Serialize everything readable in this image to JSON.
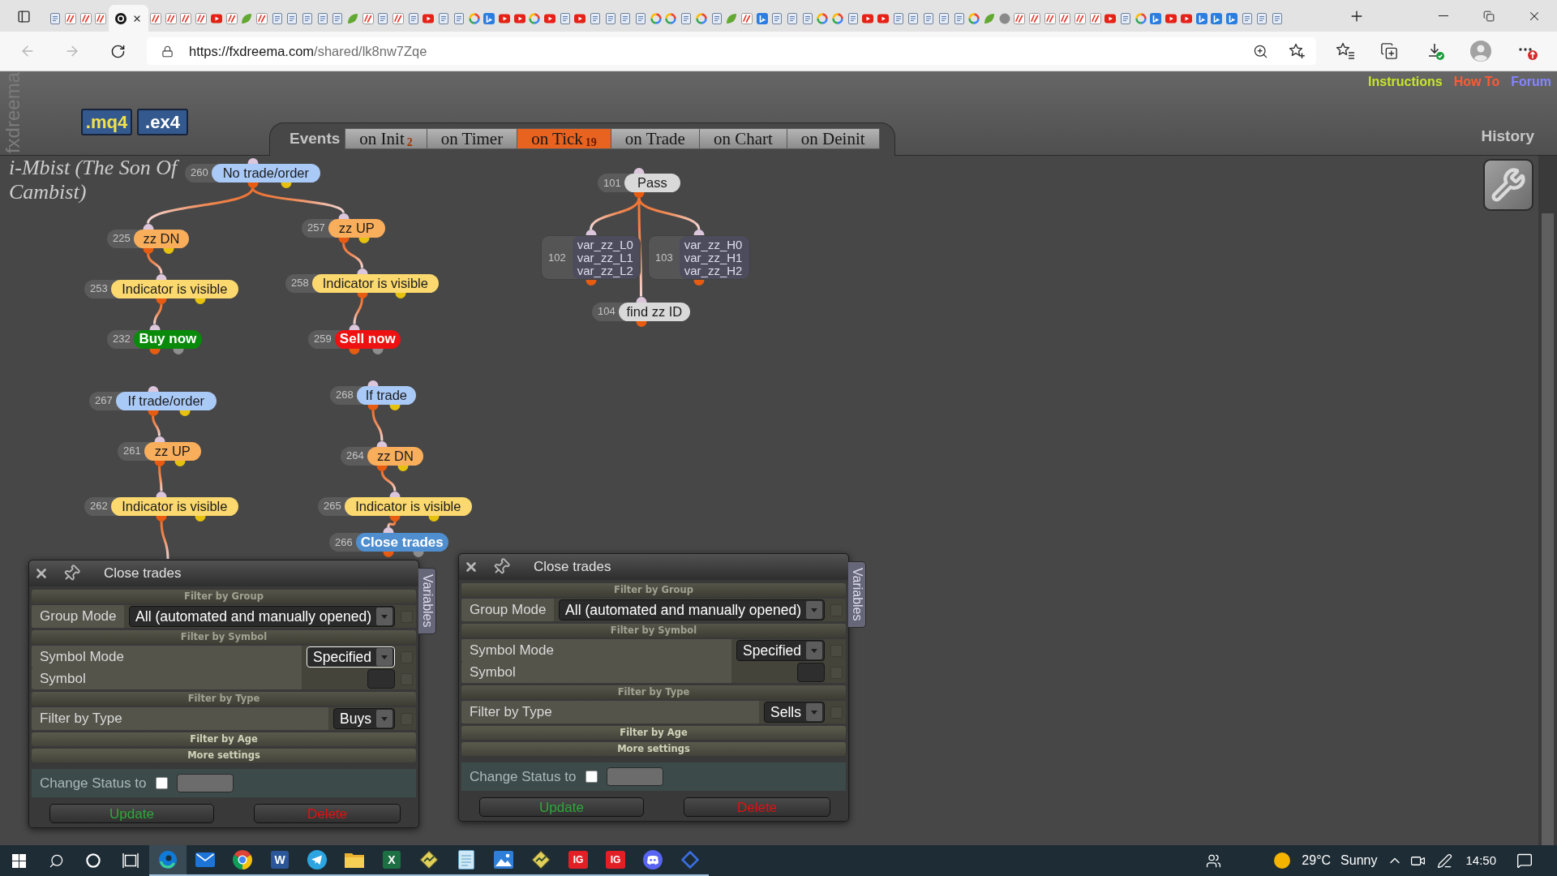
{
  "browser": {
    "tabs": [
      {
        "kind": "doc",
        "selected": false
      },
      {
        "kind": "fx",
        "selected": false
      },
      {
        "kind": "fx",
        "selected": false
      },
      {
        "kind": "fx",
        "selected": false
      },
      {
        "kind": "dark",
        "selected": true
      },
      {
        "kind": "fx",
        "selected": false
      },
      {
        "kind": "fx",
        "selected": false
      },
      {
        "kind": "fx",
        "selected": false
      },
      {
        "kind": "fx",
        "selected": false
      },
      {
        "kind": "video",
        "selected": false
      },
      {
        "kind": "fx",
        "selected": false
      },
      {
        "kind": "leaf",
        "selected": false
      },
      {
        "kind": "fx",
        "selected": false
      },
      {
        "kind": "doc",
        "selected": false
      },
      {
        "kind": "doc",
        "selected": false
      },
      {
        "kind": "doc",
        "selected": false
      },
      {
        "kind": "doc",
        "selected": false
      },
      {
        "kind": "doc",
        "selected": false
      },
      {
        "kind": "leaf",
        "selected": false
      },
      {
        "kind": "fx",
        "selected": false
      },
      {
        "kind": "doc",
        "selected": false
      },
      {
        "kind": "fx",
        "selected": false
      },
      {
        "kind": "doc",
        "selected": false
      },
      {
        "kind": "video",
        "selected": false
      },
      {
        "kind": "doc",
        "selected": false
      },
      {
        "kind": "doc",
        "selected": false
      },
      {
        "kind": "google",
        "selected": false
      },
      {
        "kind": "bing",
        "selected": false
      },
      {
        "kind": "video",
        "selected": false
      },
      {
        "kind": "video",
        "selected": false
      },
      {
        "kind": "google",
        "selected": false
      },
      {
        "kind": "video",
        "selected": false
      },
      {
        "kind": "doc",
        "selected": false
      },
      {
        "kind": "video",
        "selected": false
      },
      {
        "kind": "doc",
        "selected": false
      },
      {
        "kind": "doc",
        "selected": false
      },
      {
        "kind": "doc",
        "selected": false
      },
      {
        "kind": "doc",
        "selected": false
      },
      {
        "kind": "google",
        "selected": false
      },
      {
        "kind": "google",
        "selected": false
      },
      {
        "kind": "doc",
        "selected": false
      },
      {
        "kind": "google",
        "selected": false
      },
      {
        "kind": "doc",
        "selected": false
      },
      {
        "kind": "leaf",
        "selected": false
      },
      {
        "kind": "fx",
        "selected": false
      },
      {
        "kind": "bing",
        "selected": false
      },
      {
        "kind": "doc",
        "selected": false
      },
      {
        "kind": "doc",
        "selected": false
      },
      {
        "kind": "doc",
        "selected": false
      },
      {
        "kind": "google",
        "selected": false
      },
      {
        "kind": "google",
        "selected": false
      },
      {
        "kind": "doc",
        "selected": false
      },
      {
        "kind": "video",
        "selected": false
      },
      {
        "kind": "video",
        "selected": false
      },
      {
        "kind": "doc",
        "selected": false
      },
      {
        "kind": "doc",
        "selected": false
      },
      {
        "kind": "doc",
        "selected": false
      },
      {
        "kind": "doc",
        "selected": false
      },
      {
        "kind": "doc",
        "selected": false
      },
      {
        "kind": "google",
        "selected": false
      },
      {
        "kind": "leaf",
        "selected": false
      },
      {
        "kind": "circle",
        "selected": false
      },
      {
        "kind": "fx",
        "selected": false
      },
      {
        "kind": "fx",
        "selected": false
      },
      {
        "kind": "fx",
        "selected": false
      },
      {
        "kind": "fx",
        "selected": false
      },
      {
        "kind": "fx",
        "selected": false
      },
      {
        "kind": "fx",
        "selected": false
      },
      {
        "kind": "video",
        "selected": false
      },
      {
        "kind": "doc",
        "selected": false
      },
      {
        "kind": "google",
        "selected": false
      },
      {
        "kind": "bing",
        "selected": false
      },
      {
        "kind": "video",
        "selected": false
      },
      {
        "kind": "video",
        "selected": false
      },
      {
        "kind": "bing",
        "selected": false
      },
      {
        "kind": "bing",
        "selected": false
      },
      {
        "kind": "bing",
        "selected": false
      },
      {
        "kind": "doc",
        "selected": false
      },
      {
        "kind": "doc",
        "selected": false
      },
      {
        "kind": "doc",
        "selected": false
      }
    ],
    "address": {
      "host": "https://fxdreema.com",
      "path": "/shared/lk8nw7Zqe"
    }
  },
  "header": {
    "brand": "fxdreema",
    "export_buttons": [
      {
        "label": ".mq4",
        "color": "#f2e24a"
      },
      {
        "label": ".ex4",
        "color": "#ffffff"
      }
    ],
    "events_label": "Events",
    "event_tabs": [
      {
        "label": "on Init",
        "count": "2",
        "selected": false
      },
      {
        "label": "on Timer",
        "selected": false
      },
      {
        "label": "on Tick",
        "count": "19",
        "selected": true
      },
      {
        "label": "on Trade",
        "selected": false
      },
      {
        "label": "on Chart",
        "selected": false
      },
      {
        "label": "on Deinit",
        "selected": false
      }
    ],
    "links": [
      {
        "label": "Instructions",
        "color": "#c6e52e"
      },
      {
        "label": "How To",
        "color": "#ff5a36"
      },
      {
        "label": "Forum",
        "color": "#8585ff"
      }
    ],
    "history": "History"
  },
  "project_title": "i-Mbist (The Son Of Cambist)",
  "trees": [
    {
      "id": "260",
      "label": "No trade/order",
      "kind": "condition",
      "color": "#a9c9f7",
      "children": [
        {
          "id": "225",
          "label": "zz DN",
          "kind": "condition",
          "color": "#f9ae5c",
          "children": [
            {
              "id": "253",
              "label": "Indicator is visible",
              "kind": "condition",
              "color": "#fbd96f",
              "children": [
                {
                  "id": "232",
                  "label": "Buy now",
                  "kind": "action",
                  "color": "#0a8a0a"
                }
              ]
            }
          ]
        },
        {
          "id": "257",
          "label": "zz UP",
          "kind": "condition",
          "color": "#f9ae5c",
          "children": [
            {
              "id": "258",
              "label": "Indicator is visible",
              "kind": "condition",
              "color": "#fbd96f",
              "children": [
                {
                  "id": "259",
                  "label": "Sell now",
                  "kind": "action",
                  "color": "#ee1111"
                }
              ]
            }
          ]
        }
      ]
    },
    {
      "id": "267",
      "label": "If trade/order",
      "kind": "condition",
      "color": "#a9c9f7",
      "children": [
        {
          "id": "261",
          "label": "zz UP",
          "kind": "condition",
          "color": "#f9ae5c",
          "children": [
            {
              "id": "262",
              "label": "Indicator is visible",
              "kind": "condition",
              "color": "#fbd96f"
            }
          ]
        }
      ]
    },
    {
      "id": "268",
      "label": "If trade",
      "kind": "condition",
      "color": "#a9c9f7",
      "children": [
        {
          "id": "264",
          "label": "zz DN",
          "kind": "condition",
          "color": "#f9ae5c",
          "children": [
            {
              "id": "265",
              "label": "Indicator is visible",
              "kind": "condition",
              "color": "#fbd96f",
              "children": [
                {
                  "id": "266",
                  "label": "Close trades",
                  "kind": "action",
                  "color": "#4f8fd0"
                }
              ]
            }
          ]
        }
      ]
    },
    {
      "id": "101",
      "label": "Pass",
      "kind": "pass",
      "color": "#d9d9d9",
      "children": [
        {
          "id": "102",
          "lines": [
            "var_zz_L0",
            "var_zz_L1",
            "var_zz_L2"
          ],
          "kind": "variables",
          "color": "#4c4c5c"
        },
        {
          "id": "103",
          "lines": [
            "var_zz_H0",
            "var_zz_H1",
            "var_zz_H2"
          ],
          "kind": "variables",
          "color": "#4c4c5c"
        },
        {
          "id": "104",
          "label": "find zz ID",
          "kind": "pass",
          "color": "#d9d9d9"
        }
      ]
    }
  ],
  "dialogs": [
    {
      "title": "Close trades",
      "side_tab": "Variables",
      "sections": [
        {
          "heading": "Filter by Group",
          "expanded": true,
          "rows": [
            {
              "kind": "select",
              "label": "Group Mode",
              "value": "All (automated and manually opened)",
              "focused": false,
              "checked": false
            }
          ]
        },
        {
          "heading": "Filter by Symbol",
          "expanded": true,
          "rows": [
            {
              "kind": "select",
              "label": "Symbol Mode",
              "value": "Specified",
              "focused": true,
              "checked": false
            },
            {
              "kind": "input",
              "label": "Symbol",
              "checked": false
            }
          ]
        },
        {
          "heading": "Filter by Type",
          "expanded": true,
          "rows": [
            {
              "kind": "select",
              "label": "Filter by Type",
              "value": "Buys",
              "focused": false,
              "checked": false
            }
          ]
        },
        {
          "heading": "Filter by Age",
          "expanded": false
        },
        {
          "heading": "More settings",
          "expanded": false
        }
      ],
      "status_row": {
        "label": "Change Status to",
        "checked": false
      },
      "buttons": [
        {
          "label": "Update",
          "color": "#2fa83c"
        },
        {
          "label": "Delete",
          "color": "#e31010"
        }
      ]
    },
    {
      "title": "Close trades",
      "side_tab": "Variables",
      "sections": [
        {
          "heading": "Filter by Group",
          "expanded": true,
          "rows": [
            {
              "kind": "select",
              "label": "Group Mode",
              "value": "All (automated and manually opened)",
              "focused": false,
              "checked": false
            }
          ]
        },
        {
          "heading": "Filter by Symbol",
          "expanded": true,
          "rows": [
            {
              "kind": "select",
              "label": "Symbol Mode",
              "value": "Specified",
              "focused": false,
              "checked": false
            },
            {
              "kind": "input",
              "label": "Symbol",
              "checked": false
            }
          ]
        },
        {
          "heading": "Filter by Type",
          "expanded": true,
          "rows": [
            {
              "kind": "select",
              "label": "Filter by Type",
              "value": "Sells",
              "focused": false,
              "checked": false
            }
          ]
        },
        {
          "heading": "Filter by Age",
          "expanded": false
        },
        {
          "heading": "More settings",
          "expanded": false
        }
      ],
      "status_row": {
        "label": "Change Status to",
        "checked": false
      },
      "buttons": [
        {
          "label": "Update",
          "color": "#2fa83c"
        },
        {
          "label": "Delete",
          "color": "#e31010"
        }
      ]
    }
  ],
  "taskbar": {
    "apps": [
      {
        "kind": "edge",
        "selected": true,
        "open": true
      },
      {
        "kind": "mail",
        "selected": false,
        "open": true
      },
      {
        "kind": "chrome",
        "selected": false,
        "open": true
      },
      {
        "kind": "word",
        "glyph": "W",
        "selected": false,
        "open": true
      },
      {
        "kind": "telegram",
        "selected": false,
        "open": true
      },
      {
        "kind": "explorer",
        "selected": false,
        "open": true
      },
      {
        "kind": "excel",
        "glyph": "X",
        "selected": false,
        "open": true
      },
      {
        "kind": "chart",
        "selected": false,
        "open": true
      },
      {
        "kind": "notepad",
        "selected": false,
        "open": true
      },
      {
        "kind": "photos",
        "selected": false,
        "open": true
      },
      {
        "kind": "chart",
        "selected": false,
        "open": true
      },
      {
        "kind": "ig",
        "glyph": "IG",
        "selected": false,
        "open": true
      },
      {
        "kind": "ig",
        "glyph": "IG",
        "selected": false,
        "open": true
      },
      {
        "kind": "discord",
        "selected": false,
        "open": true
      },
      {
        "kind": "diamond",
        "selected": false,
        "open": true
      }
    ],
    "temperature": "29°C",
    "weather": "Sunny",
    "clock": "14:50"
  }
}
